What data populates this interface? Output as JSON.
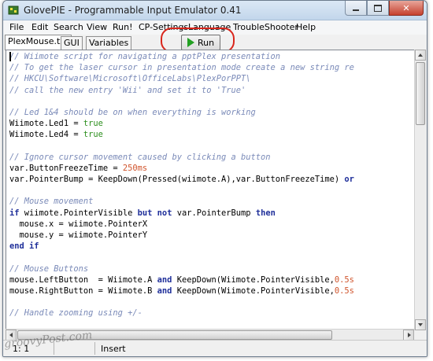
{
  "window": {
    "title": "GlovePIE - Programmable Input Emulator 0.41"
  },
  "menu": [
    "File",
    "Edit",
    "Search",
    "View",
    "Run!",
    "CP-Settings",
    "Language",
    "TroubleShooter",
    "Help"
  ],
  "tabs": [
    "PlexMouse.txt",
    "GUI",
    "Variables"
  ],
  "toolbar": {
    "run_label": "Run"
  },
  "code_lines": [
    [
      {
        "t": "// Wiimote script for navigating a pptPlex presentation",
        "c": "cmt"
      }
    ],
    [
      {
        "t": "// To get the laser cursor in presentation mode create a new string re",
        "c": "cmt"
      }
    ],
    [
      {
        "t": "// HKCU\\Software\\Microsoft\\OfficeLabs\\PlexPorPPT\\",
        "c": "cmt"
      }
    ],
    [
      {
        "t": "// call the new entry 'Wii' and set it to 'True'",
        "c": "cmt"
      }
    ],
    [],
    [
      {
        "t": "// Led 1&4 should be on when everything is working",
        "c": "cmt"
      }
    ],
    [
      {
        "t": "Wiimote.Led1 = "
      },
      {
        "t": "true",
        "c": "tru"
      }
    ],
    [
      {
        "t": "Wiimote.Led4 = "
      },
      {
        "t": "true",
        "c": "tru"
      }
    ],
    [],
    [
      {
        "t": "// Ignore cursor movement caused by clicking a button",
        "c": "cmt"
      }
    ],
    [
      {
        "t": "var.ButtonFreezeTime = "
      },
      {
        "t": "250ms",
        "c": "num"
      }
    ],
    [
      {
        "t": "var.PointerBump = KeepDown(Pressed(wiimote.A),var.ButtonFreezeTime) "
      },
      {
        "t": "or",
        "c": "kw"
      }
    ],
    [],
    [
      {
        "t": "// Mouse movement",
        "c": "cmt"
      }
    ],
    [
      {
        "t": "if",
        "c": "kw"
      },
      {
        "t": " wiimote.PointerVisible "
      },
      {
        "t": "but not",
        "c": "kw"
      },
      {
        "t": " var.PointerBump "
      },
      {
        "t": "then",
        "c": "kw"
      }
    ],
    [
      {
        "t": "  mouse.x = wiimote.PointerX"
      }
    ],
    [
      {
        "t": "  mouse.y = wiimote.PointerY"
      }
    ],
    [
      {
        "t": "end if",
        "c": "kw"
      }
    ],
    [],
    [
      {
        "t": "// Mouse Buttons",
        "c": "cmt"
      }
    ],
    [
      {
        "t": "mouse.LeftButton  = Wiimote.A "
      },
      {
        "t": "and",
        "c": "kw"
      },
      {
        "t": " KeepDown(Wiimote.PointerVisible,"
      },
      {
        "t": "0.5s",
        "c": "num"
      }
    ],
    [
      {
        "t": "mouse.RightButton = Wiimote.B "
      },
      {
        "t": "and",
        "c": "kw"
      },
      {
        "t": " KeepDown(Wiimote.PointerVisible,"
      },
      {
        "t": "0.5s",
        "c": "num"
      }
    ],
    [],
    [
      {
        "t": "// Handle zooming using +/-",
        "c": "cmt"
      }
    ]
  ],
  "status": {
    "position": "1: 1",
    "mode": "Insert"
  },
  "watermark": "groovyPost.com",
  "colors": {
    "comment": "#7a8ab8",
    "keyword": "#1f2f9a",
    "number": "#d0542c",
    "boolean": "#2d8f1e",
    "highlight_ring": "#d9261c"
  }
}
